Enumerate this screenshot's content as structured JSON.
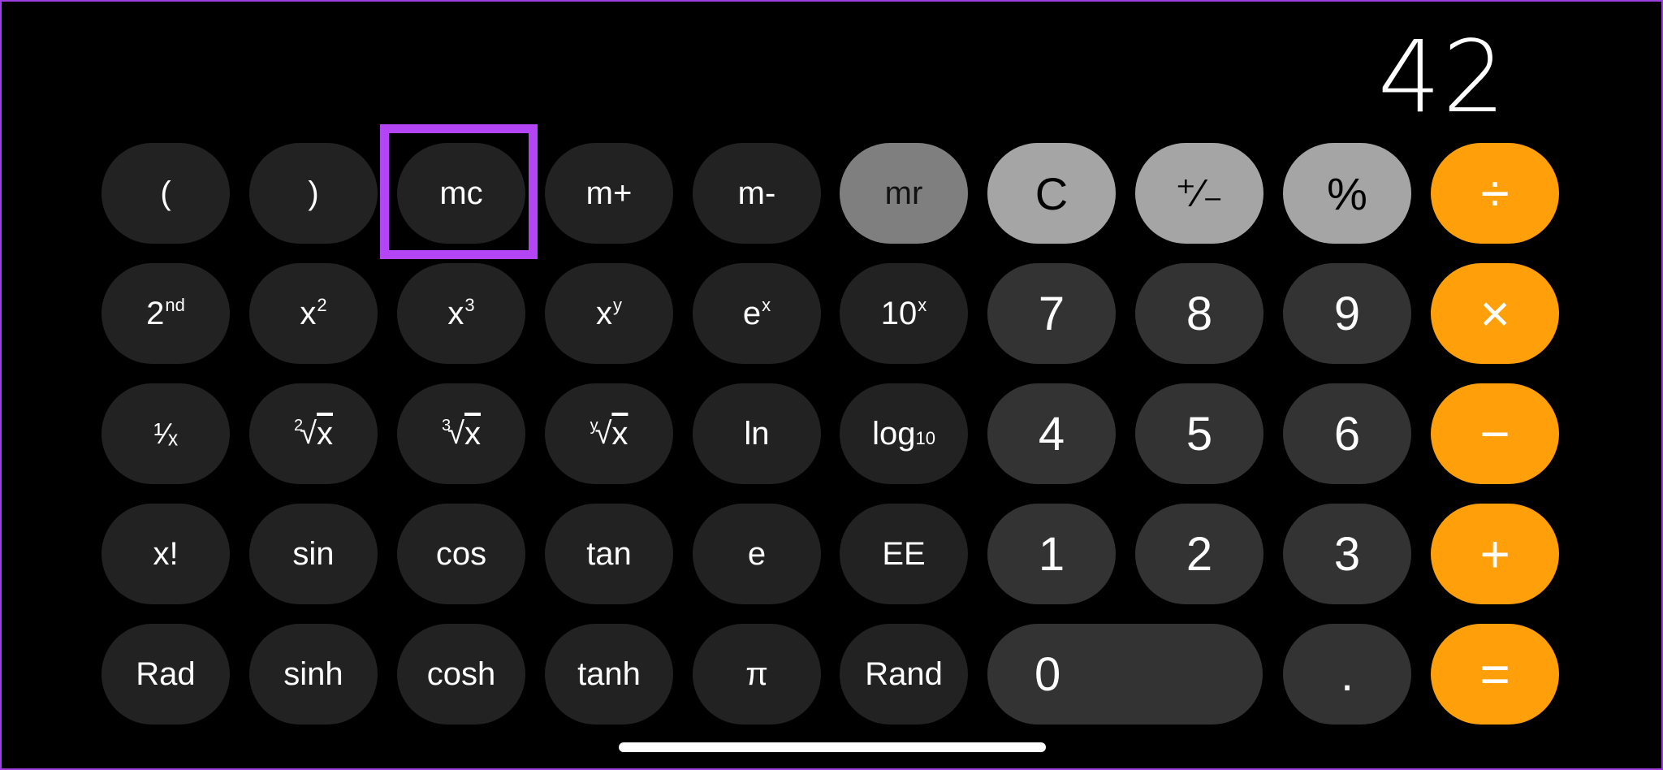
{
  "display": {
    "value": "42"
  },
  "highlight": {
    "target": "mc",
    "color": "#b445f5"
  },
  "colors": {
    "background": "#000000",
    "scientific_key": "#222222",
    "digit_key": "#333333",
    "function_key": "#a5a5a5",
    "memory_recall_active": "#7f7f7f",
    "operator_key": "#ff9f0a",
    "frame_border": "#9b3fe0"
  },
  "rows": [
    {
      "keys": [
        {
          "id": "open-paren",
          "label": "("
        },
        {
          "id": "close-paren",
          "label": ")"
        },
        {
          "id": "mc",
          "label": "mc"
        },
        {
          "id": "m-plus",
          "label": "m+"
        },
        {
          "id": "m-minus",
          "label": "m-"
        },
        {
          "id": "mr",
          "label": "mr"
        },
        {
          "id": "clear",
          "label": "C"
        },
        {
          "id": "plus-minus",
          "label": "⁺∕₋"
        },
        {
          "id": "percent",
          "label": "%"
        },
        {
          "id": "divide",
          "label": "÷"
        }
      ]
    },
    {
      "keys": [
        {
          "id": "second",
          "base": "2",
          "sup": "nd"
        },
        {
          "id": "x-squared",
          "base": "x",
          "sup": "2"
        },
        {
          "id": "x-cubed",
          "base": "x",
          "sup": "3"
        },
        {
          "id": "x-to-y",
          "base": "x",
          "sup": "y"
        },
        {
          "id": "e-to-x",
          "base": "e",
          "sup": "x"
        },
        {
          "id": "ten-to-x",
          "base": "10",
          "sup": "x"
        },
        {
          "id": "seven",
          "label": "7"
        },
        {
          "id": "eight",
          "label": "8"
        },
        {
          "id": "nine",
          "label": "9"
        },
        {
          "id": "multiply",
          "label": "×"
        }
      ]
    },
    {
      "keys": [
        {
          "id": "reciprocal",
          "label": "¹∕ₓ"
        },
        {
          "id": "square-root",
          "index": "2",
          "radicand": "x"
        },
        {
          "id": "cube-root",
          "index": "3",
          "radicand": "x"
        },
        {
          "id": "y-root",
          "index": "y",
          "radicand": "x"
        },
        {
          "id": "ln",
          "label": "ln"
        },
        {
          "id": "log10",
          "base": "log",
          "sub": "10"
        },
        {
          "id": "four",
          "label": "4"
        },
        {
          "id": "five",
          "label": "5"
        },
        {
          "id": "six",
          "label": "6"
        },
        {
          "id": "subtract",
          "label": "−"
        }
      ]
    },
    {
      "keys": [
        {
          "id": "factorial",
          "label": "x!"
        },
        {
          "id": "sin",
          "label": "sin"
        },
        {
          "id": "cos",
          "label": "cos"
        },
        {
          "id": "tan",
          "label": "tan"
        },
        {
          "id": "euler",
          "label": "e"
        },
        {
          "id": "ee",
          "label": "EE"
        },
        {
          "id": "one",
          "label": "1"
        },
        {
          "id": "two",
          "label": "2"
        },
        {
          "id": "three",
          "label": "3"
        },
        {
          "id": "add",
          "label": "+"
        }
      ]
    },
    {
      "keys": [
        {
          "id": "rad",
          "label": "Rad"
        },
        {
          "id": "sinh",
          "label": "sinh"
        },
        {
          "id": "cosh",
          "label": "cosh"
        },
        {
          "id": "tanh",
          "label": "tanh"
        },
        {
          "id": "pi",
          "label": "π"
        },
        {
          "id": "rand",
          "label": "Rand"
        },
        {
          "id": "zero",
          "label": "0"
        },
        {
          "id": "decimal",
          "label": "."
        },
        {
          "id": "equals",
          "label": "="
        }
      ]
    }
  ]
}
